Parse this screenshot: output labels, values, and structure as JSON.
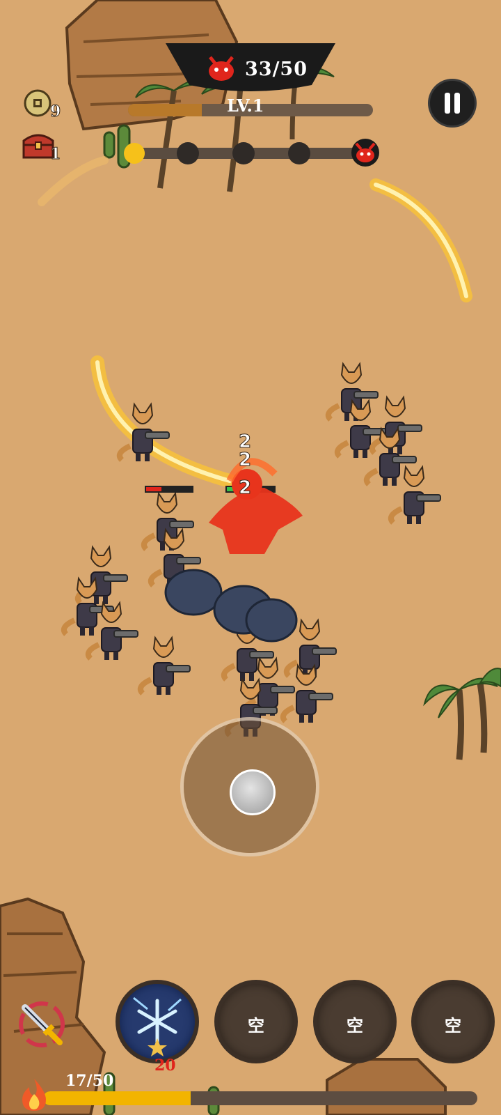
{
  "hud": {
    "kills_text": "33/50",
    "kills_current": 33,
    "kills_target": 50,
    "level_text": "LV.1",
    "xp_progress": 0.3,
    "wave_progress": 0.06,
    "wave_markers": 4,
    "coins": "9",
    "chests": "1"
  },
  "battle": {
    "damage_numbers": [
      "2",
      "2",
      "2"
    ],
    "enemy_type": "fox-gunner",
    "hero": "red-flame-swordsman"
  },
  "skills": {
    "slot1": "ice-nova",
    "slot2_label": "空",
    "slot3_label": "空",
    "slot4_label": "空",
    "ice_cost": "20"
  },
  "energy": {
    "text": "17/50",
    "current": 17,
    "max": 50
  },
  "colors": {
    "sand": "#d9a870",
    "gold": "#f2b400",
    "enemy_red": "#e0251c",
    "slot_dark": "#4a3c31"
  }
}
